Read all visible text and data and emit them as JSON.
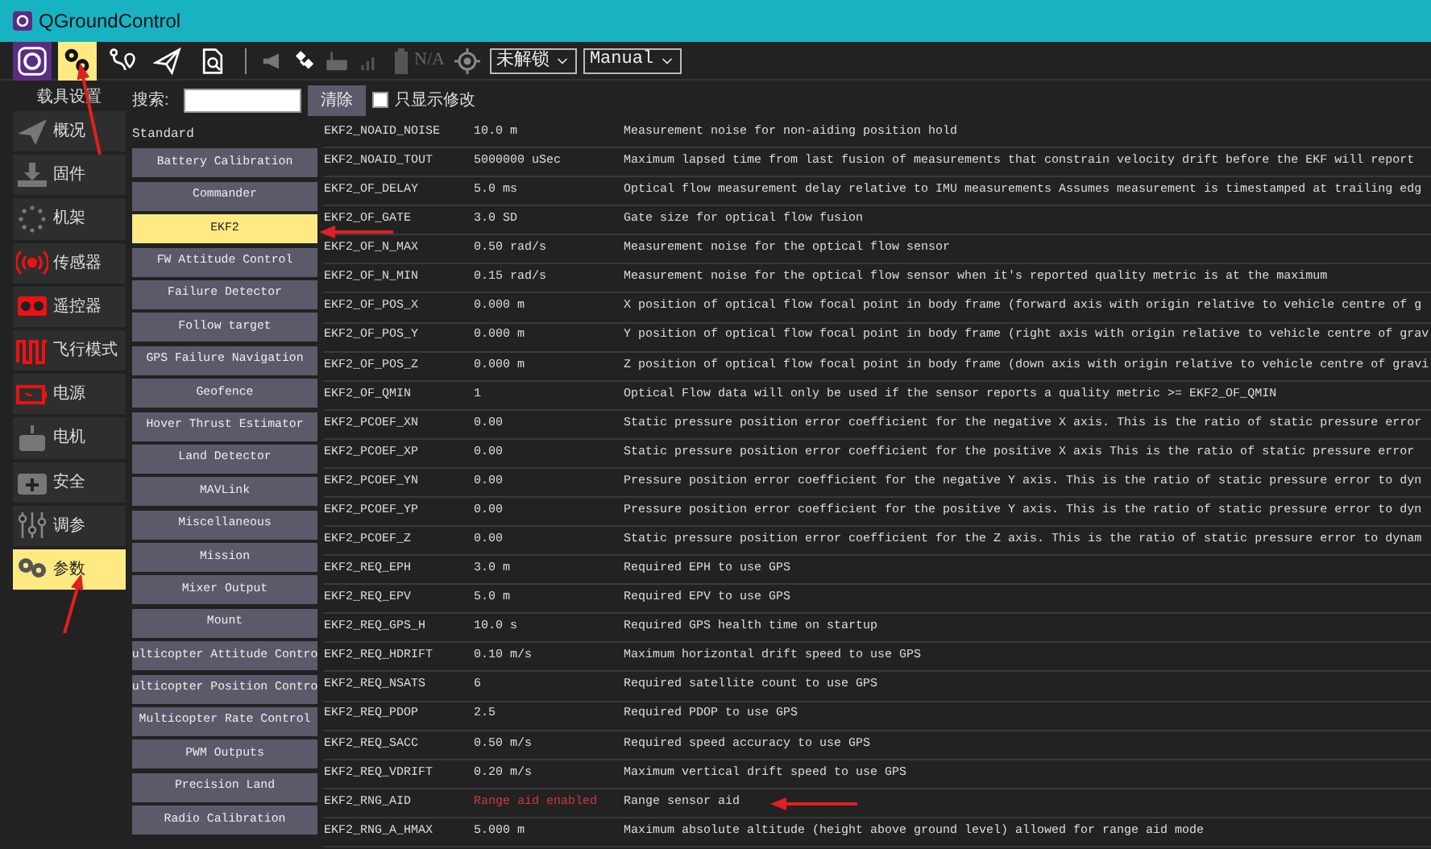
{
  "window": {
    "title": "QGroundControl"
  },
  "toolbar": {
    "items": [
      {
        "kind": "logo",
        "selected": false
      },
      {
        "kind": "gears",
        "selected": true
      },
      {
        "kind": "route",
        "selected": false
      },
      {
        "kind": "plane",
        "selected": false
      },
      {
        "kind": "report",
        "selected": false
      }
    ],
    "status": [
      {
        "kind": "megaphone"
      },
      {
        "kind": "satellite"
      },
      {
        "kind": "remote"
      },
      {
        "kind": "signal"
      }
    ],
    "battery": "N/A",
    "arm_dropdown": "未解锁",
    "mode_dropdown": "Manual"
  },
  "sidebar": {
    "header": "载具设置",
    "items": [
      {
        "label": "概况",
        "kind": "plane",
        "selected": false
      },
      {
        "label": "固件",
        "kind": "download",
        "selected": false
      },
      {
        "label": "机架",
        "kind": "frame",
        "selected": false
      },
      {
        "label": "传感器",
        "kind": "sensor",
        "selected": false
      },
      {
        "label": "遥控器",
        "kind": "remote",
        "selected": false
      },
      {
        "label": "飞行模式",
        "kind": "wave",
        "selected": false
      },
      {
        "label": "电源",
        "kind": "battery",
        "selected": false
      },
      {
        "label": "电机",
        "kind": "motor",
        "selected": false
      },
      {
        "label": "安全",
        "kind": "safety",
        "selected": false
      },
      {
        "label": "调参",
        "kind": "sliders",
        "selected": false
      },
      {
        "label": "参数",
        "kind": "gears",
        "selected": true
      }
    ]
  },
  "search": {
    "label": "搜索:",
    "clear_button": "清除",
    "modified_only": {
      "label": "只显示修改",
      "checked": false
    }
  },
  "categories": {
    "group": "Standard",
    "items": [
      {
        "label": "Battery Calibration",
        "selected": false
      },
      {
        "label": "Commander",
        "selected": false
      },
      {
        "label": "EKF2",
        "selected": true
      },
      {
        "label": "FW Attitude Control",
        "selected": false
      },
      {
        "label": "Failure Detector",
        "selected": false
      },
      {
        "label": "Follow target",
        "selected": false
      },
      {
        "label": "GPS Failure Navigation",
        "selected": false
      },
      {
        "label": "Geofence",
        "selected": false
      },
      {
        "label": "Hover Thrust Estimator",
        "selected": false
      },
      {
        "label": "Land Detector",
        "selected": false
      },
      {
        "label": "MAVLink",
        "selected": false
      },
      {
        "label": "Miscellaneous",
        "selected": false
      },
      {
        "label": "Mission",
        "selected": false
      },
      {
        "label": "Mixer Output",
        "selected": false
      },
      {
        "label": "Mount",
        "selected": false
      },
      {
        "label": "ulticopter Attitude Contro",
        "selected": false
      },
      {
        "label": "ulticopter Position Contro",
        "selected": false
      },
      {
        "label": "Multicopter Rate Control",
        "selected": false
      },
      {
        "label": "PWM Outputs",
        "selected": false
      },
      {
        "label": "Precision Land",
        "selected": false
      },
      {
        "label": "Radio Calibration",
        "selected": false
      }
    ]
  },
  "parameters": [
    {
      "name": "EKF2_NOAID_NOISE",
      "value": "10.0 m",
      "description": "Measurement noise for non-aiding position hold",
      "modified": false
    },
    {
      "name": "EKF2_NOAID_TOUT",
      "value": "5000000 uSec",
      "description": "Maximum lapsed time from last fusion of measurements that constrain velocity drift before the EKF will report",
      "modified": false
    },
    {
      "name": "EKF2_OF_DELAY",
      "value": "5.0 ms",
      "description": "Optical flow measurement delay relative to IMU measurements Assumes measurement is timestamped at trailing edg",
      "modified": false
    },
    {
      "name": "EKF2_OF_GATE",
      "value": "3.0 SD",
      "description": "Gate size for optical flow fusion",
      "modified": false
    },
    {
      "name": "EKF2_OF_N_MAX",
      "value": "0.50 rad/s",
      "description": "Measurement noise for the optical flow sensor",
      "modified": false
    },
    {
      "name": "EKF2_OF_N_MIN",
      "value": "0.15 rad/s",
      "description": "Measurement noise for the optical flow sensor when it's reported quality metric is at the maximum",
      "modified": false
    },
    {
      "name": "EKF2_OF_POS_X",
      "value": "0.000 m",
      "description": "X position of optical flow focal point in body frame (forward axis with origin relative to vehicle centre of g",
      "modified": false
    },
    {
      "name": "EKF2_OF_POS_Y",
      "value": "0.000 m",
      "description": "Y position of optical flow focal point in body frame (right axis with origin relative to vehicle centre of grav",
      "modified": false
    },
    {
      "name": "EKF2_OF_POS_Z",
      "value": "0.000 m",
      "description": "Z position of optical flow focal point in body frame (down axis with origin relative to vehicle centre of gravi",
      "modified": false
    },
    {
      "name": "EKF2_OF_QMIN",
      "value": "1",
      "description": "Optical Flow data will only be used if the sensor reports a quality metric >= EKF2_OF_QMIN",
      "modified": false
    },
    {
      "name": "EKF2_PCOEF_XN",
      "value": "0.00",
      "description": "Static pressure position error coefficient for the negative X axis. This is the ratio of static pressure error",
      "modified": false
    },
    {
      "name": "EKF2_PCOEF_XP",
      "value": "0.00",
      "description": "Static pressure position error coefficient for the positive X axis This is the ratio of static pressure error",
      "modified": false
    },
    {
      "name": "EKF2_PCOEF_YN",
      "value": "0.00",
      "description": "Pressure position error coefficient for the negative Y axis. This is the ratio of static pressure error to dyn",
      "modified": false
    },
    {
      "name": "EKF2_PCOEF_YP",
      "value": "0.00",
      "description": "Pressure position error coefficient for the positive Y axis. This is the ratio of static pressure error to dyn",
      "modified": false
    },
    {
      "name": "EKF2_PCOEF_Z",
      "value": "0.00",
      "description": "Static pressure position error coefficient for the Z axis. This is the ratio of static pressure error to dynam",
      "modified": false
    },
    {
      "name": "EKF2_REQ_EPH",
      "value": "3.0 m",
      "description": "Required EPH to use GPS",
      "modified": false
    },
    {
      "name": "EKF2_REQ_EPV",
      "value": "5.0 m",
      "description": "Required EPV to use GPS",
      "modified": false
    },
    {
      "name": "EKF2_REQ_GPS_H",
      "value": "10.0 s",
      "description": "Required GPS health time on startup",
      "modified": false
    },
    {
      "name": "EKF2_REQ_HDRIFT",
      "value": "0.10 m/s",
      "description": "Maximum horizontal drift speed to use GPS",
      "modified": false
    },
    {
      "name": "EKF2_REQ_NSATS",
      "value": "6",
      "description": "Required satellite count to use GPS",
      "modified": false
    },
    {
      "name": "EKF2_REQ_PDOP",
      "value": "2.5",
      "description": "Required PDOP to use GPS",
      "modified": false
    },
    {
      "name": "EKF2_REQ_SACC",
      "value": "0.50 m/s",
      "description": "Required speed accuracy to use GPS",
      "modified": false
    },
    {
      "name": "EKF2_REQ_VDRIFT",
      "value": "0.20 m/s",
      "description": "Maximum vertical drift speed to use GPS",
      "modified": false
    },
    {
      "name": "EKF2_RNG_AID",
      "value": "Range aid enabled",
      "description": "Range sensor aid",
      "modified": true
    },
    {
      "name": "EKF2_RNG_A_HMAX",
      "value": "5.000 m",
      "description": "Maximum absolute altitude (height above ground level) allowed for range aid mode",
      "modified": false
    }
  ]
}
